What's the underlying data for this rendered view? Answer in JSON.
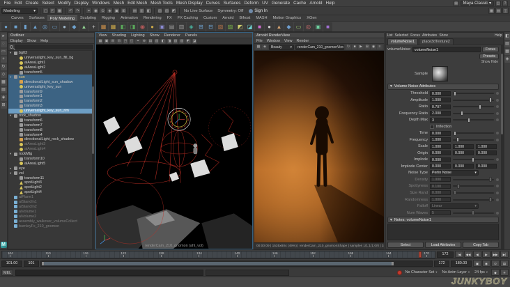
{
  "watermark": "JUNKYBOY",
  "menubar": {
    "items": [
      "File",
      "Edit",
      "Create",
      "Select",
      "Modify",
      "Display",
      "Windows",
      "Mesh",
      "Edit Mesh",
      "Mesh Tools",
      "Mesh Display",
      "Curves",
      "Surfaces",
      "Deform",
      "UV",
      "Generate",
      "Cache",
      "Arnold",
      "Help"
    ],
    "workspace": "Maya Classic",
    "workspace_caret": "▾"
  },
  "statusline": {
    "menuset": "Modeling",
    "menuset_caret": "▾",
    "icons_file": [
      "▢",
      "◰",
      "▦"
    ],
    "icons_undo": [
      "↶",
      "↷"
    ],
    "icons_snap": [
      "⌖",
      "◉",
      "⊙",
      "◈",
      "▣",
      "⊞"
    ],
    "icons_hist": [
      "▤",
      "▥",
      "◧"
    ],
    "icons_render": [
      "▧",
      "▨",
      "◩"
    ],
    "no_live": "No Live Surface",
    "symmetry": "Symmetry: Off",
    "sign_in": "Sign In",
    "icons_right": [
      "▦",
      "▤",
      "◫"
    ]
  },
  "shelf": {
    "tabs": [
      "Curves",
      "Surfaces",
      "Poly Modeling",
      "Sculpting",
      "Rigging",
      "Animation",
      "Rendering",
      "FX",
      "FX Caching",
      "Custom",
      "Arnold",
      "Bifrost",
      "MASH",
      "Motion Graphics",
      "XGen"
    ],
    "active_tab": "Poly Modeling",
    "icons": [
      {
        "g": "●",
        "c": "#6fa3d0"
      },
      {
        "g": "■",
        "c": "#6fa3d0"
      },
      {
        "g": "▮",
        "c": "#6fa3d0"
      },
      {
        "g": "▲",
        "c": "#6fa3d0"
      },
      {
        "g": "◎",
        "c": "#6fa3d0"
      },
      {
        "g": "▭",
        "c": "#6fa3d0"
      },
      {
        "g": "●",
        "c": "#9fb7c9"
      },
      {
        "g": "◆",
        "c": "#6fa3d0"
      },
      {
        "g": "▲",
        "c": "#8fd08f"
      },
      {
        "g": "+",
        "c": "#c9c9c9"
      },
      {
        "g": "▦",
        "c": "#c98f4a"
      },
      {
        "g": "▦",
        "c": "#caa84a"
      },
      {
        "g": "◧",
        "c": "#5aa85a"
      },
      {
        "g": "◨",
        "c": "#5aa85a"
      },
      {
        "g": "◉",
        "c": "#b55a5a"
      },
      {
        "g": "●",
        "c": "#caa84a"
      },
      {
        "g": "▣",
        "c": "#8a8ad0"
      },
      {
        "g": "▤",
        "c": "#9a9a9a"
      },
      {
        "g": "▥",
        "c": "#9a9a9a"
      },
      {
        "g": "◈",
        "c": "#4ab5a0"
      },
      {
        "g": "⊞",
        "c": "#6fa3d0"
      },
      {
        "g": "⊟",
        "c": "#6fa3d0"
      },
      {
        "g": "▧",
        "c": "#b5744a"
      },
      {
        "g": "▨",
        "c": "#7ab54a"
      },
      {
        "g": "◩",
        "c": "#d0d06f"
      },
      {
        "g": "◪",
        "c": "#6fd0d0"
      },
      {
        "g": "■",
        "c": "#d06fd0"
      },
      {
        "g": "●",
        "c": "#d0d0d0"
      },
      {
        "g": "▲",
        "c": "#d09f6f"
      },
      {
        "g": "◆",
        "c": "#6f9fd0"
      },
      {
        "g": "▭",
        "c": "#9fd06f"
      },
      {
        "g": "◎",
        "c": "#d06f6f"
      },
      {
        "g": "▣",
        "c": "#6fd09f"
      },
      {
        "g": "■",
        "c": "#9f6fd0"
      }
    ]
  },
  "toolbox": {
    "icons": [
      "▸",
      "◌",
      "▭",
      "+",
      "↻",
      "◇",
      "▦",
      "▤",
      "◈",
      "⊞"
    ]
  },
  "rightstrip": {
    "icons": [
      "◧",
      "▤",
      "▦",
      "◈"
    ]
  },
  "outliner": {
    "title": "Outliner",
    "menus": [
      "Display",
      "Show",
      "Help"
    ],
    "items": [
      {
        "n": "bg03",
        "exp": "▾",
        "icls": "ic-trans",
        "cls": "lvl1"
      },
      {
        "n": "universalight_key_sun_fill_bg",
        "exp": "",
        "icls": "ic-light",
        "cls": "lvl2"
      },
      {
        "n": "aiAreaLight1",
        "exp": "",
        "icls": "ic-light",
        "cls": "lvl2"
      },
      {
        "n": "aiAreaLight2",
        "exp": "",
        "icls": "ic-light",
        "cls": "lvl2"
      },
      {
        "n": "transform5",
        "exp": "",
        "icls": "ic-trans",
        "cls": "lvl2"
      },
      {
        "n": "sun",
        "exp": "▾",
        "icls": "ic-trans",
        "cls": "lvl1 sel ref"
      },
      {
        "n": "directionalLight_sun_shadow",
        "exp": "",
        "icls": "ic-dlight",
        "cls": "lvl2 sel"
      },
      {
        "n": "universalight_key_sun",
        "exp": "",
        "icls": "ic-light",
        "cls": "lvl2 sel"
      },
      {
        "n": "transform9",
        "exp": "",
        "icls": "ic-trans",
        "cls": "lvl2 sel"
      },
      {
        "n": "transform1",
        "exp": "",
        "icls": "ic-trans",
        "cls": "lvl2 sel"
      },
      {
        "n": "transform2",
        "exp": "",
        "icls": "ic-trans",
        "cls": "lvl2 sel"
      },
      {
        "n": "transform3",
        "exp": "",
        "icls": "ic-trans",
        "cls": "lvl2 sel"
      },
      {
        "n": "universalight_key_sun_rim",
        "exp": "",
        "icls": "ic-light",
        "cls": "lvl2 act"
      },
      {
        "n": "rock_shadow",
        "exp": "▾",
        "icls": "ic-trans",
        "cls": "lvl1"
      },
      {
        "n": "transform6",
        "exp": "",
        "icls": "ic-trans",
        "cls": "lvl2"
      },
      {
        "n": "transform7",
        "exp": "",
        "icls": "ic-trans",
        "cls": "lvl2"
      },
      {
        "n": "transform8",
        "exp": "",
        "icls": "ic-trans",
        "cls": "lvl2"
      },
      {
        "n": "transform4",
        "exp": "",
        "icls": "ic-trans",
        "cls": "lvl2"
      },
      {
        "n": "directionalLight_rock_shadow",
        "exp": "",
        "icls": "ic-dlight",
        "cls": "lvl2"
      },
      {
        "n": "aiAreaLight3",
        "exp": "",
        "icls": "ic-light",
        "cls": "lvl2 dim"
      },
      {
        "n": "aiAreaLight4",
        "exp": "",
        "icls": "ic-light",
        "cls": "lvl2 dim"
      },
      {
        "n": "rockMtg",
        "exp": "▾",
        "icls": "ic-trans",
        "cls": "lvl1"
      },
      {
        "n": "transform10",
        "exp": "",
        "icls": "ic-trans",
        "cls": "lvl2"
      },
      {
        "n": "aiAreaLight5",
        "exp": "",
        "icls": "ic-light",
        "cls": "lvl2"
      },
      {
        "n": "eye",
        "exp": "▸",
        "icls": "ic-trans",
        "cls": "lvl1"
      },
      {
        "n": "vol",
        "exp": "▾",
        "icls": "ic-trans",
        "cls": "lvl1"
      },
      {
        "n": "transform11",
        "exp": "",
        "icls": "ic-trans",
        "cls": "lvl2"
      },
      {
        "n": "spotLight3",
        "exp": "",
        "icls": "ic-slight",
        "cls": "lvl2"
      },
      {
        "n": "spotLight2",
        "exp": "",
        "icls": "ic-slight",
        "cls": "lvl2"
      },
      {
        "n": "spotLight4",
        "exp": "",
        "icls": "ic-slight",
        "cls": "lvl2"
      },
      {
        "n": "aiPlane1",
        "exp": "",
        "icls": "ic-geo",
        "cls": "lvl1 dim"
      },
      {
        "n": "aiStandIn1",
        "exp": "",
        "icls": "ic-geo",
        "cls": "lvl1 dim"
      },
      {
        "n": "aiStandIn2",
        "exp": "",
        "icls": "ic-geo",
        "cls": "lvl1 dim"
      },
      {
        "n": "aiVolume1",
        "exp": "",
        "icls": "ic-geo",
        "cls": "lvl1 dim"
      },
      {
        "n": "aiVolume2",
        "exp": "",
        "icls": "ic-geo",
        "cls": "lvl1 dim"
      },
      {
        "n": "assembly_walkover_volumeCollect",
        "exp": "",
        "icls": "ic-geo",
        "cls": "lvl1 dim"
      },
      {
        "n": "burnleyFx_210_gnomon",
        "exp": "",
        "icls": "ic-geo",
        "cls": "lvl1 dim"
      }
    ]
  },
  "viewport": {
    "menus": [
      "View",
      "Shading",
      "Lighting",
      "Show",
      "Renderer",
      "Panels"
    ],
    "icons": [
      "▦",
      "▣",
      "⊞",
      "⊟",
      "◳",
      "◱",
      "⌖",
      "⊕",
      "▤",
      "▥",
      "◧",
      "◨",
      "▧",
      "▨",
      "◩",
      "◪"
    ],
    "camera_label": "renderCam_210_gnomon (ahl_vol)"
  },
  "renderview": {
    "title": "Arnold RenderView",
    "menus": [
      "File",
      "Window",
      "View",
      "Render"
    ],
    "aov": "Beauty",
    "aov_caret": "▾",
    "camera": "renderCam_210_gnomonView",
    "camera_caret": "▾",
    "icons_left": [
      "▦",
      "◈"
    ],
    "icons_right": [
      "↻",
      "■",
      "▶",
      "⊞",
      "◉",
      "≡"
    ],
    "status": "00:00:09 | 1535x804 (49%) | renderCam_210_gnomonShape | samples 1/1:1/1:0/0 | 34.5 fps"
  },
  "ae": {
    "menus": [
      "List",
      "Selected",
      "Focus",
      "Attributes",
      "Show",
      "Help"
    ],
    "tabs": [
      "volumeNoise1",
      "place3dTexture2"
    ],
    "node_type_label": "volumeNoise:",
    "node_name": "volumeNoise1",
    "focus_btn": "Focus",
    "presets_btn": "Presets",
    "show_hide": "Show Hide",
    "sample_label": "Sample",
    "section_caret": "▾",
    "section_title": "Volume Noise Attributes",
    "rows": {
      "threshold": {
        "label": "Threshold",
        "value": "0.000"
      },
      "amplitude": {
        "label": "Amplitude",
        "value": "1.000"
      },
      "ratio": {
        "label": "Ratio",
        "value": "0.707"
      },
      "freq_ratio": {
        "label": "Frequency Ratio",
        "value": "2.000"
      },
      "depth_max": {
        "label": "Depth Max",
        "value": "3"
      },
      "inflection": {
        "label": "Inflection"
      },
      "time": {
        "label": "Time",
        "value": "0.000"
      },
      "frequency": {
        "label": "Frequency",
        "value": "1.000"
      },
      "scale": {
        "label": "Scale",
        "v1": "1.000",
        "v2": "1.000",
        "v3": "1.000"
      },
      "origin": {
        "label": "Origin",
        "v1": "0.000",
        "v2": "0.000",
        "v3": "0.000"
      },
      "implode": {
        "label": "Implode",
        "value": "0.000"
      },
      "implode_center": {
        "label": "Implode Center",
        "v1": "0.000",
        "v2": "0.000",
        "v3": "0.000"
      },
      "noise_type": {
        "label": "Noise Type",
        "value": "Perlin Noise",
        "caret": "▾"
      },
      "density": {
        "label": "Density",
        "value": "1.000"
      },
      "spottyness": {
        "label": "Spottyness",
        "value": "0.100"
      },
      "size_rand": {
        "label": "Size Rand",
        "value": "0.000"
      },
      "randomness": {
        "label": "Randomness",
        "value": "1.000"
      },
      "falloff": {
        "label": "Falloff",
        "value": "Linear",
        "caret": "▾"
      },
      "num_waves": {
        "label": "Num Waves",
        "value": "5"
      }
    },
    "notes_caret": "▾",
    "notes_title": "Notes: volumeNoise1",
    "buttons": [
      "Select",
      "Load Attributes",
      "Copy Tab"
    ]
  },
  "timeline": {
    "ticks": [
      "104",
      "110",
      "116",
      "122",
      "128",
      "134",
      "140",
      "146",
      "152",
      "158",
      "164",
      "170"
    ],
    "current_frame": "172",
    "transport": [
      "|◀",
      "◀◀",
      "◀",
      "▶",
      "▶▶",
      "▶|"
    ],
    "anim_start": "101.00",
    "play_start": "101",
    "play_end": "172",
    "anim_end": "180.00",
    "rowb_icons": [
      "▣",
      "◉",
      "⊙",
      "▤"
    ],
    "mel_label": "MEL",
    "char_set": "No Character Set",
    "anim_layer": "No Anim Layer",
    "fps": "24 fps",
    "caret": "▾",
    "rowc_icons": [
      "◆",
      "✳"
    ]
  },
  "colors": {
    "selection_blue": "#3c6383",
    "active_selection": "#6d9ec4",
    "autokey_red": "#c23b2e",
    "render_orange": "#a55a1c",
    "timeline_marker": "#b0493a"
  }
}
